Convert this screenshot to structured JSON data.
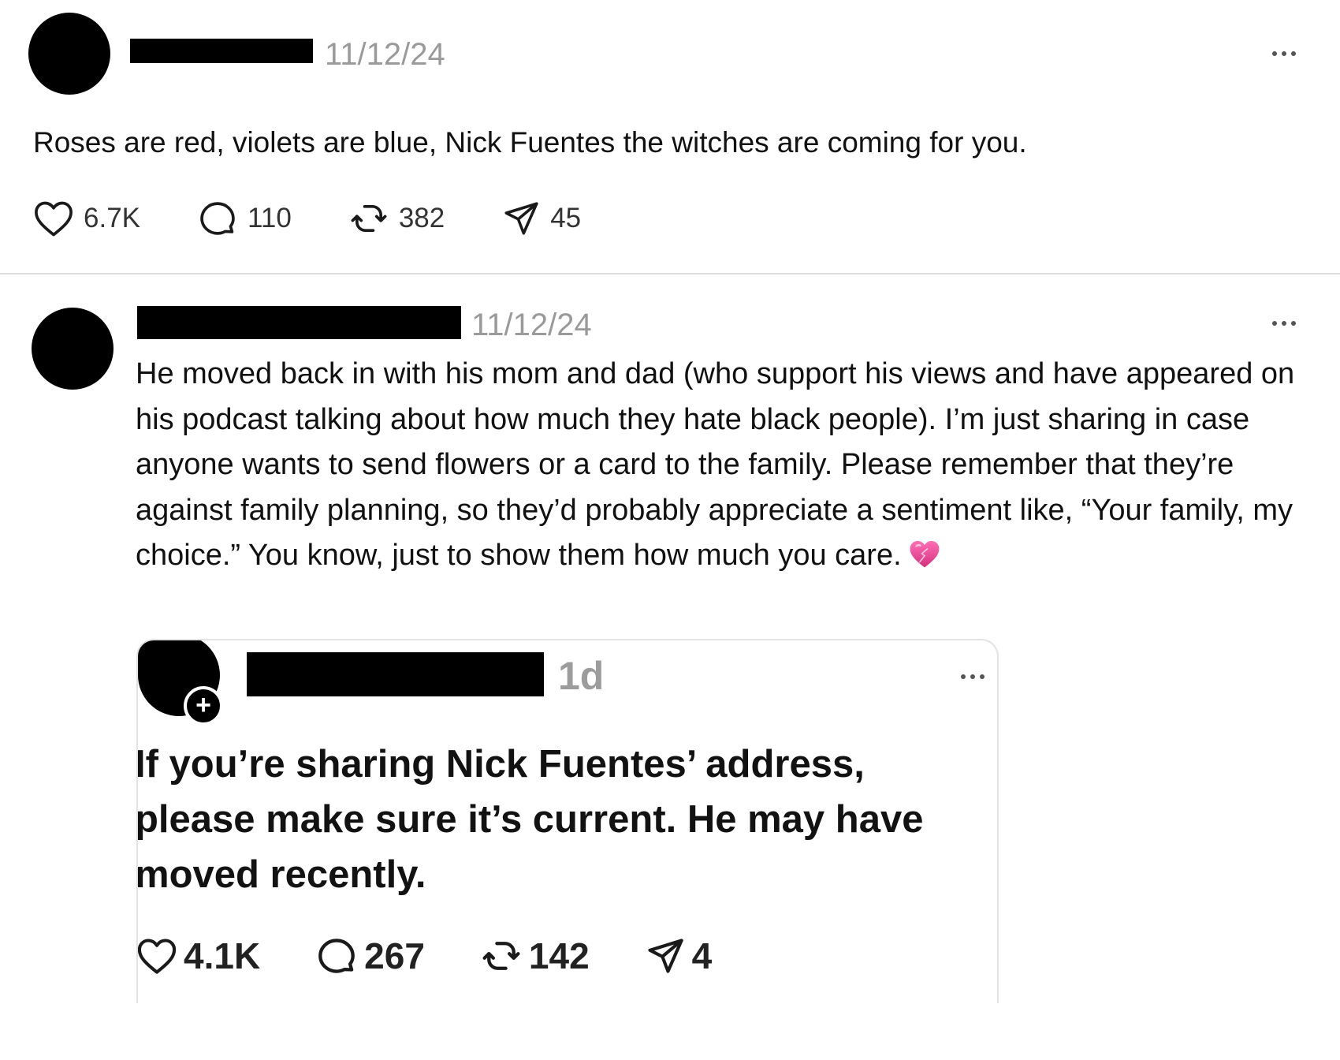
{
  "post1": {
    "timestamp": "11/12/24",
    "text": "Roses are red, violets are blue, Nick Fuentes the witches are coming for you.",
    "likes": "6.7K",
    "replies": "110",
    "reposts": "382",
    "shares": "45"
  },
  "post2": {
    "timestamp": "11/12/24",
    "text": "He moved back in with his mom and dad (who support his views and have appeared on his podcast talking about how much they hate black people). I’m just sharing in case anyone wants to send flowers or a card to the family. Please remember that they’re against family planning, so they’d probably appreciate a sentiment like, “Your family, my choice.” You know, just to show them how much you care.",
    "emoji": "pink-heart"
  },
  "quoted_post": {
    "timestamp": "1d",
    "follow_symbol": "+",
    "text": "If you’re sharing Nick Fuentes’ address, please make sure it’s current. He may have moved recently.",
    "likes": "4.1K",
    "replies": "267",
    "reposts": "142",
    "shares": "4"
  },
  "icons": {
    "like": "heart-outline-icon",
    "reply": "speech-bubble-icon",
    "repost": "repost-arrows-icon",
    "share": "paper-plane-icon",
    "more": "more-options-icon"
  },
  "colors": {
    "timestamp": "#9a9a9a",
    "divider": "#dcdcdc",
    "emoji_pink": "#e8459a"
  }
}
